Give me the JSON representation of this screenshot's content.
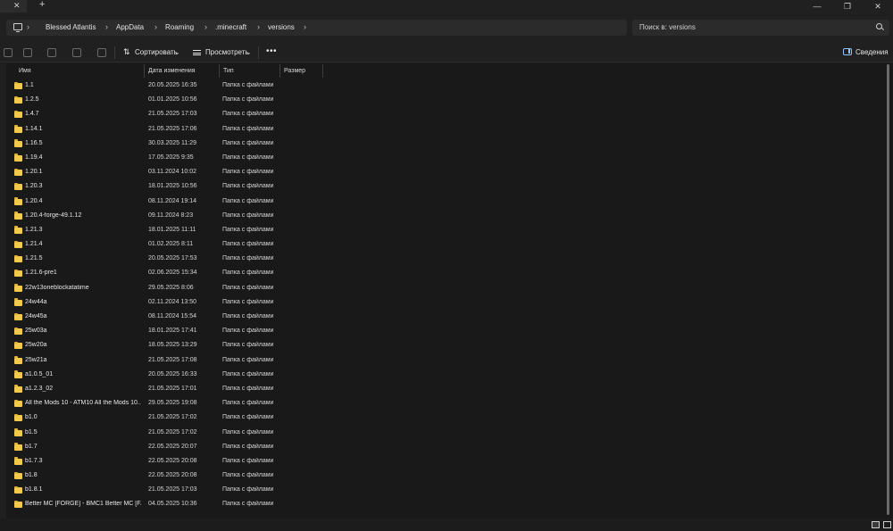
{
  "titlebar": {
    "tab_close": "✕",
    "new_tab": "+",
    "minimize": "—",
    "maximize": "❐",
    "close": "✕"
  },
  "breadcrumbs": [
    "Blessed Atlantis",
    "AppData",
    "Roaming",
    ".minecraft",
    "versions"
  ],
  "search": {
    "placeholder": "Поиск в: versions"
  },
  "toolbar": {
    "sort_label": "Сортировать",
    "view_label": "Просмотреть",
    "more": "•••",
    "details_label": "Сведения"
  },
  "columns": {
    "name": "Имя",
    "date": "Дата изменения",
    "type": "Тип",
    "size": "Размер"
  },
  "files": [
    {
      "name": "1.1",
      "date": "20.05.2025 16:35",
      "type": "Папка с файлами"
    },
    {
      "name": "1.2.5",
      "date": "01.01.2025 10:56",
      "type": "Папка с файлами"
    },
    {
      "name": "1.4.7",
      "date": "21.05.2025 17:03",
      "type": "Папка с файлами"
    },
    {
      "name": "1.14.1",
      "date": "21.05.2025 17:06",
      "type": "Папка с файлами"
    },
    {
      "name": "1.16.5",
      "date": "30.03.2025 11:29",
      "type": "Папка с файлами"
    },
    {
      "name": "1.19.4",
      "date": "17.05.2025 9:35",
      "type": "Папка с файлами"
    },
    {
      "name": "1.20.1",
      "date": "03.11.2024 10:02",
      "type": "Папка с файлами"
    },
    {
      "name": "1.20.3",
      "date": "18.01.2025 10:56",
      "type": "Папка с файлами"
    },
    {
      "name": "1.20.4",
      "date": "08.11.2024 19:14",
      "type": "Папка с файлами"
    },
    {
      "name": "1.20.4-forge-49.1.12",
      "date": "09.11.2024 8:23",
      "type": "Папка с файлами"
    },
    {
      "name": "1.21.3",
      "date": "18.01.2025 11:11",
      "type": "Папка с файлами"
    },
    {
      "name": "1.21.4",
      "date": "01.02.2025 8:11",
      "type": "Папка с файлами"
    },
    {
      "name": "1.21.5",
      "date": "20.05.2025 17:53",
      "type": "Папка с файлами"
    },
    {
      "name": "1.21.6-pre1",
      "date": "02.06.2025 15:34",
      "type": "Папка с файлами"
    },
    {
      "name": "22w13oneblockatatime",
      "date": "29.05.2025 8:06",
      "type": "Папка с файлами"
    },
    {
      "name": "24w44a",
      "date": "02.11.2024 13:50",
      "type": "Папка с файлами"
    },
    {
      "name": "24w45a",
      "date": "08.11.2024 15:54",
      "type": "Папка с файлами"
    },
    {
      "name": "25w03a",
      "date": "18.01.2025 17:41",
      "type": "Папка с файлами"
    },
    {
      "name": "25w20a",
      "date": "18.05.2025 13:29",
      "type": "Папка с файлами"
    },
    {
      "name": "25w21a",
      "date": "21.05.2025 17:08",
      "type": "Папка с файлами"
    },
    {
      "name": "a1.0.5_01",
      "date": "20.05.2025 16:33",
      "type": "Папка с файлами"
    },
    {
      "name": "a1.2.3_02",
      "date": "21.05.2025 17:01",
      "type": "Папка с файлами"
    },
    {
      "name": "All the Mods 10 - ATM10 All the Mods 10...",
      "date": "29.05.2025 19:08",
      "type": "Папка с файлами"
    },
    {
      "name": "b1.0",
      "date": "21.05.2025 17:02",
      "type": "Папка с файлами"
    },
    {
      "name": "b1.5",
      "date": "21.05.2025 17:02",
      "type": "Папка с файлами"
    },
    {
      "name": "b1.7",
      "date": "22.05.2025 20:07",
      "type": "Папка с файлами"
    },
    {
      "name": "b1.7.3",
      "date": "22.05.2025 20:08",
      "type": "Папка с файлами"
    },
    {
      "name": "b1.8",
      "date": "22.05.2025 20:08",
      "type": "Папка с файлами"
    },
    {
      "name": "b1.8.1",
      "date": "21.05.2025 17:03",
      "type": "Папка с файлами"
    },
    {
      "name": "Better MC [FORGE] - BMC1 Better MC [F...",
      "date": "04.05.2025 10:36",
      "type": "Папка с файлами"
    }
  ]
}
